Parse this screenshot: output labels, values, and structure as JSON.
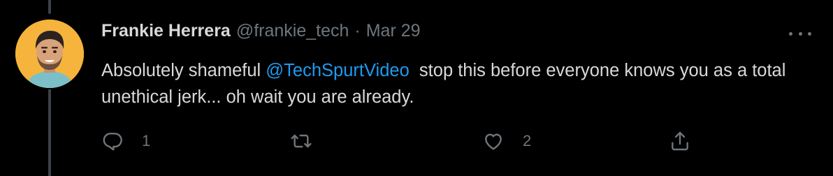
{
  "tweet": {
    "display_name": "Frankie Herrera",
    "handle": "@frankie_tech",
    "separator": "·",
    "date": "Mar 29",
    "text_before": "Absolutely shameful ",
    "mention": "@TechSpurtVideo",
    "text_after": "  stop this before everyone knows you as a total unethical jerk... oh wait you are already."
  },
  "actions": {
    "reply_count": "1",
    "retweet_count": "",
    "like_count": "2"
  },
  "colors": {
    "background": "#000000",
    "text": "#d9d9d9",
    "muted": "#6e767d",
    "mention": "#1d9bf0",
    "avatar_bg": "#f6b43c"
  },
  "icons": [
    "reply-icon",
    "retweet-icon",
    "like-icon",
    "share-icon",
    "more-icon"
  ]
}
